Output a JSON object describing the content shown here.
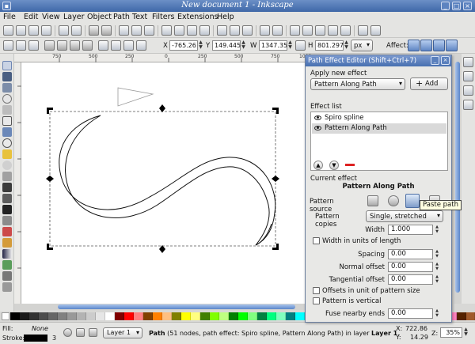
{
  "window": {
    "title": "New document 1 - Inkscape"
  },
  "menu": [
    "File",
    "Edit",
    "View",
    "Layer",
    "Object",
    "Path",
    "Text",
    "Filters",
    "Extensions",
    "Help"
  ],
  "toolcontrols": {
    "x_label": "X",
    "x_value": "-765.26",
    "y_label": "Y",
    "y_value": "149.445",
    "w_label": "W",
    "w_value": "1347.35",
    "h_label": "H",
    "h_value": "801.297",
    "unit": "px",
    "affect_label": "Affect:"
  },
  "ruler": {
    "h_labels": [
      "750",
      "500",
      "250",
      "0",
      "250",
      "500",
      "750",
      "1000"
    ]
  },
  "dialog": {
    "title": "Path Effect Editor (Shift+Ctrl+7)",
    "apply_group": "Apply new effect",
    "effect_choice": "Pattern Along Path",
    "add_label": "Add",
    "list_group": "Effect list",
    "effects": [
      {
        "name": "Spiro spline",
        "selected": false
      },
      {
        "name": "Pattern Along Path",
        "selected": true
      }
    ],
    "current_group": "Current effect",
    "current_name": "Pattern Along Path",
    "pattern_source_label": "Pattern source",
    "copies_label": "Pattern copies",
    "copies_value": "Single, stretched",
    "width_label": "Width",
    "width_value": "1.000",
    "width_units_label": "Width in units of length",
    "spacing_label": "Spacing",
    "spacing_value": "0.00",
    "normal_offset_label": "Normal offset",
    "normal_offset_value": "0.00",
    "tangential_offset_label": "Tangential offset",
    "tangential_offset_value": "0.00",
    "offsets_unit_label": "Offsets in unit of pattern size",
    "vertical_label": "Pattern is vertical",
    "fuse_label": "Fuse nearby ends",
    "fuse_value": "0.00",
    "tooltip": "Paste path"
  },
  "status": {
    "fill_label": "Fill:",
    "fill_value": "None",
    "stroke_label": "Stroke:",
    "stroke_width": "3",
    "layer": "Layer 1",
    "message_bold": "Path",
    "message": " (51 nodes, path effect: Spiro spline, Pattern Along Path) in layer ",
    "message_layer": "Layer 1",
    "message_end": ".",
    "x_label": "X:",
    "x_value": "722.86",
    "y_label": "Y:",
    "y_value": "14.29",
    "z_label": "Z:",
    "z_value": "35%"
  },
  "colors": {
    "accent": "#4a72b3",
    "selection": "#d9d9d9"
  },
  "icons": {
    "toolbox": [
      "selector-icon",
      "node-icon",
      "tweak-icon",
      "zoom-icon",
      "measure-icon",
      "rect-icon",
      "3dbox-icon",
      "ellipse-icon",
      "star-icon",
      "spiral-icon",
      "pencil-icon",
      "pen-icon",
      "calligraphy-icon",
      "text-icon",
      "spray-icon",
      "eraser-icon",
      "bucket-icon",
      "gradient-icon",
      "mesh-icon",
      "dropper-icon",
      "connector-icon"
    ]
  }
}
